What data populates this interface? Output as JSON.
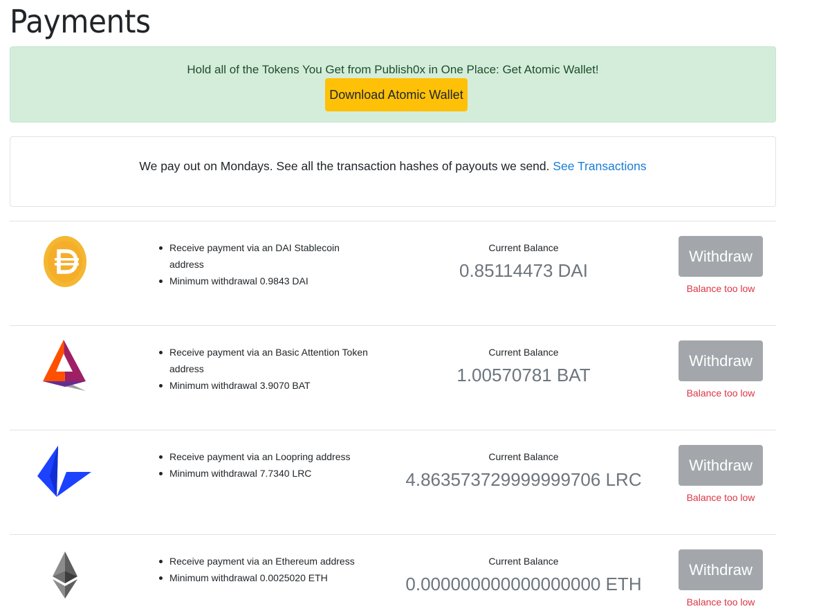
{
  "page": {
    "title": "Payments"
  },
  "promo": {
    "text": "Hold all of the Tokens You Get from Publish0x in One Place: Get Atomic Wallet!",
    "button_label": "Download Atomic Wallet"
  },
  "info": {
    "text": "We pay out on Mondays. See all the transaction hashes of payouts we send. ",
    "link_label": "See Transactions"
  },
  "balance_label": "Current Balance",
  "withdraw_label": "Withdraw",
  "low_balance_message": "Balance too low",
  "coins": [
    {
      "icon": "dai-icon",
      "receive_text": "Receive payment via an DAI Stablecoin address",
      "minimum_text": "Minimum withdrawal 0.9843 DAI",
      "balance": "0.85114473 DAI"
    },
    {
      "icon": "bat-icon",
      "receive_text": "Receive payment via an Basic Attention Token address",
      "minimum_text": "Minimum withdrawal 3.9070 BAT",
      "balance": "1.00570781 BAT"
    },
    {
      "icon": "loopring-icon",
      "receive_text": "Receive payment via an Loopring address",
      "minimum_text": "Minimum withdrawal 7.7340 LRC",
      "balance": "4.863573729999999706 LRC"
    },
    {
      "icon": "ethereum-icon",
      "receive_text": "Receive payment via an Ethereum address",
      "minimum_text": "Minimum withdrawal 0.0025020 ETH",
      "balance": "0.000000000000000000 ETH"
    }
  ],
  "colors": {
    "promo_bg": "#d4eddb",
    "promo_button": "#ffc107",
    "link": "#1a7bd6",
    "withdraw_disabled": "#a3a7ab",
    "error_text": "#dc3545"
  }
}
